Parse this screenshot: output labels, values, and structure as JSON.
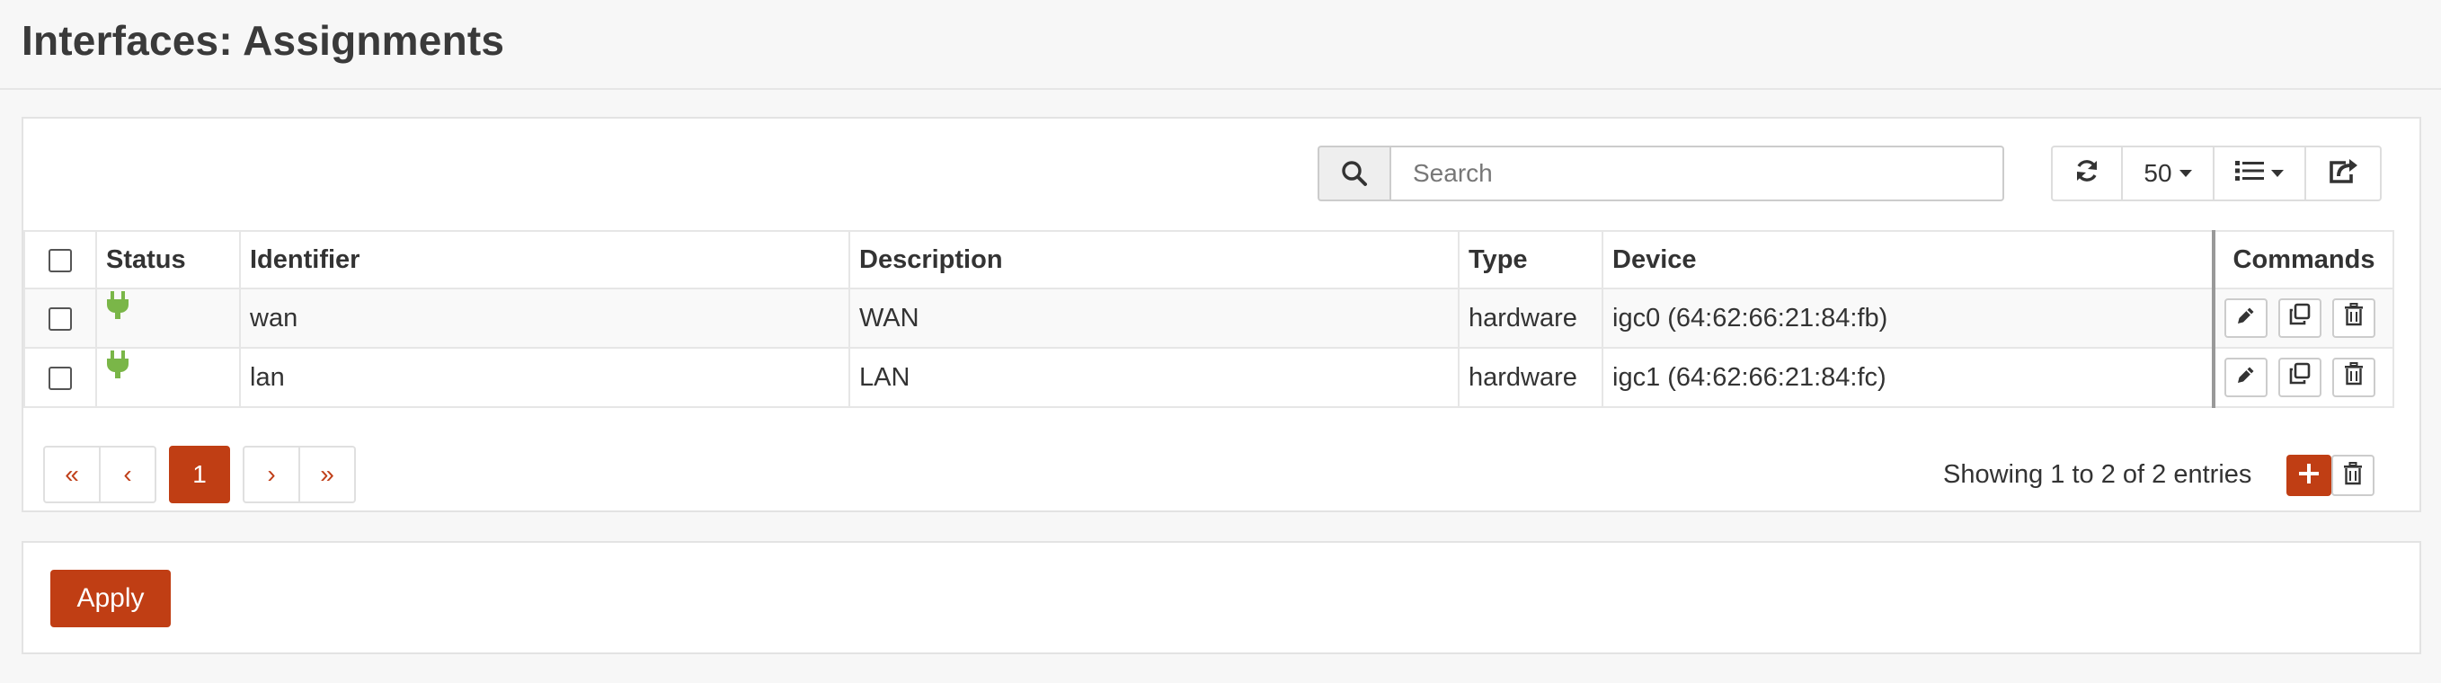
{
  "page": {
    "title": "Interfaces: Assignments"
  },
  "toolbar": {
    "search_placeholder": "Search",
    "page_size": "50"
  },
  "table": {
    "columns": [
      "Status",
      "Identifier",
      "Description",
      "Type",
      "Device",
      "Commands"
    ],
    "rows": [
      {
        "status_icon": "plug-icon",
        "identifier": "wan",
        "description": "WAN",
        "type": "hardware",
        "device": "igc0 (64:62:66:21:84:fb)"
      },
      {
        "status_icon": "plug-icon",
        "identifier": "lan",
        "description": "LAN",
        "type": "hardware",
        "device": "igc1 (64:62:66:21:84:fc)"
      }
    ]
  },
  "pagination": {
    "first": "«",
    "prev": "‹",
    "current": "1",
    "next": "›",
    "last": "»",
    "info": "Showing 1 to 2 of 2 entries"
  },
  "actions": {
    "apply_label": "Apply"
  },
  "colors": {
    "accent": "#c03e14",
    "status_ok": "#7ab648"
  }
}
